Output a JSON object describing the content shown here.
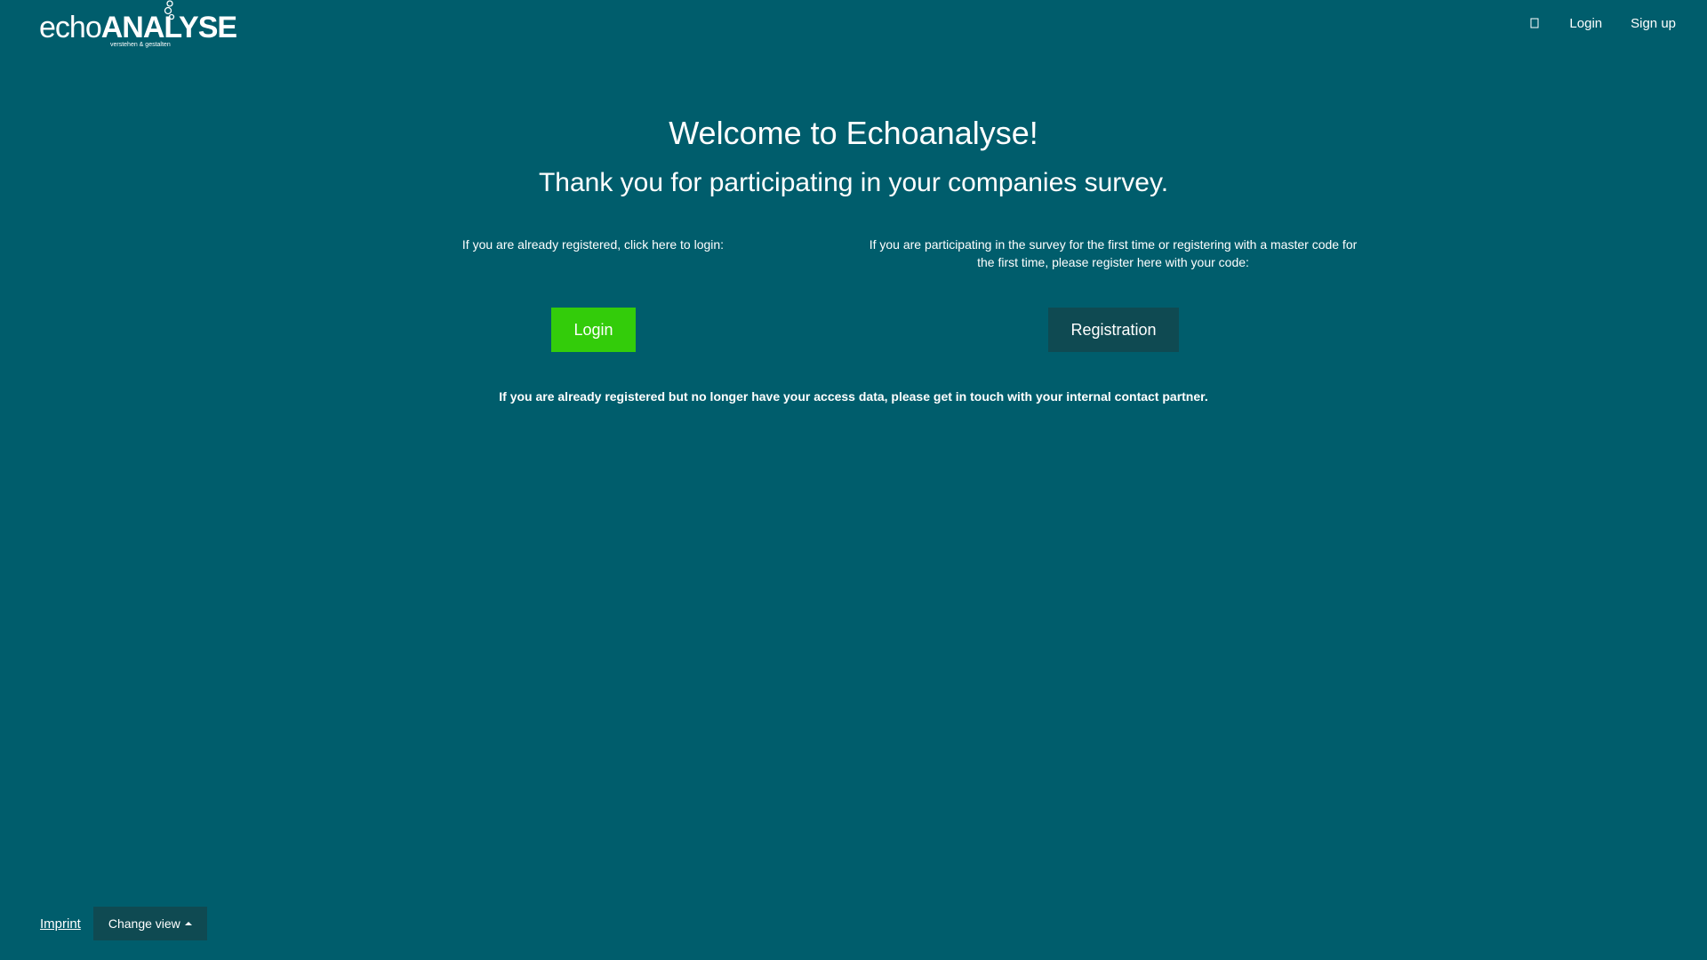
{
  "header": {
    "logo": {
      "word_light": "echo",
      "word_bold": "ANALYSE",
      "tagline": "verstehen & gestalten"
    },
    "nav_icon": "info-icon",
    "nav": {
      "login": "Login",
      "signup": "Sign up"
    }
  },
  "main": {
    "title": "Welcome to Echoanalyse!",
    "subtitle": "Thank you for participating in your companies survey.",
    "login_col": {
      "text": "If you are already registered, click here to login:",
      "button": "Login"
    },
    "register_col": {
      "text": "If you are participating in the survey for the first time or registering with a master code for the first time, please register here with your code:",
      "button": "Registration"
    },
    "notice": "If you are already registered but no longer have your access data, please get in touch with your internal contact partner."
  },
  "footer": {
    "imprint": "Imprint",
    "change_view": "Change view"
  },
  "colors": {
    "background": "#005d6c",
    "login_button": "#33cc0a",
    "dark_button": "#0f4a52"
  }
}
